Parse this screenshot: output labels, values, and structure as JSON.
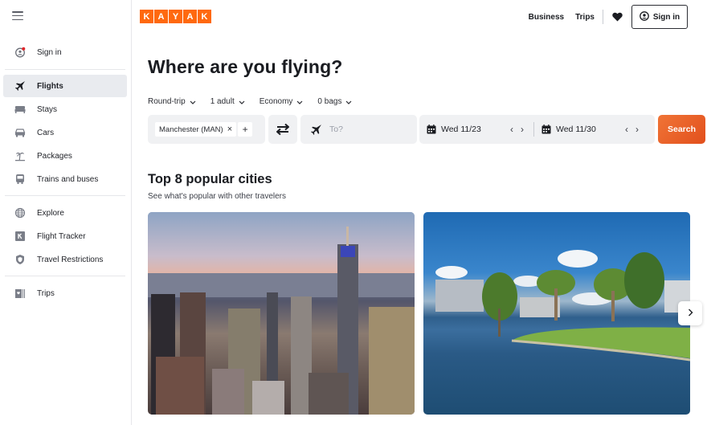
{
  "brand": {
    "logo_letters": [
      "K",
      "A",
      "Y",
      "A",
      "K"
    ],
    "accent_color": "#ff690f"
  },
  "sidebar": {
    "menu_icon": "hamburger-icon",
    "items": [
      {
        "label": "Sign in",
        "icon": "user-notification-icon",
        "active": false
      },
      {
        "label": "Flights",
        "icon": "plane-icon",
        "active": true
      },
      {
        "label": "Stays",
        "icon": "bed-icon",
        "active": false
      },
      {
        "label": "Cars",
        "icon": "car-icon",
        "active": false
      },
      {
        "label": "Packages",
        "icon": "palm-tree-icon",
        "active": false
      },
      {
        "label": "Trains and buses",
        "icon": "train-icon",
        "active": false
      },
      {
        "label": "Explore",
        "icon": "globe-icon",
        "active": false
      },
      {
        "label": "Flight Tracker",
        "icon": "k-badge-icon",
        "active": false
      },
      {
        "label": "Travel Restrictions",
        "icon": "shield-icon",
        "active": false
      },
      {
        "label": "Trips",
        "icon": "trips-icon",
        "active": false
      }
    ]
  },
  "header": {
    "links": [
      "Business",
      "Trips"
    ],
    "favorites_icon": "heart-icon",
    "sign_in_label": "Sign in"
  },
  "search": {
    "title": "Where are you flying?",
    "options": [
      {
        "label": "Round-trip"
      },
      {
        "label": "1 adult"
      },
      {
        "label": "Economy"
      },
      {
        "label": "0 bags"
      }
    ],
    "origin_chip": "Manchester (MAN)",
    "origin_remove": "×",
    "origin_add": "+",
    "destination_placeholder": "To?",
    "depart_date": "Wed 11/23",
    "return_date": "Wed 11/30",
    "prev_glyph": "‹",
    "next_glyph": "›",
    "search_label": "Search",
    "search_color": "#e8582a"
  },
  "popular": {
    "title": "Top 8 popular cities",
    "subtitle": "See what's popular with other travelers",
    "cards": [
      {
        "image": "city-skyline-dusk"
      },
      {
        "image": "lake-palm-trees-skyline"
      }
    ],
    "next_glyph": "›"
  }
}
